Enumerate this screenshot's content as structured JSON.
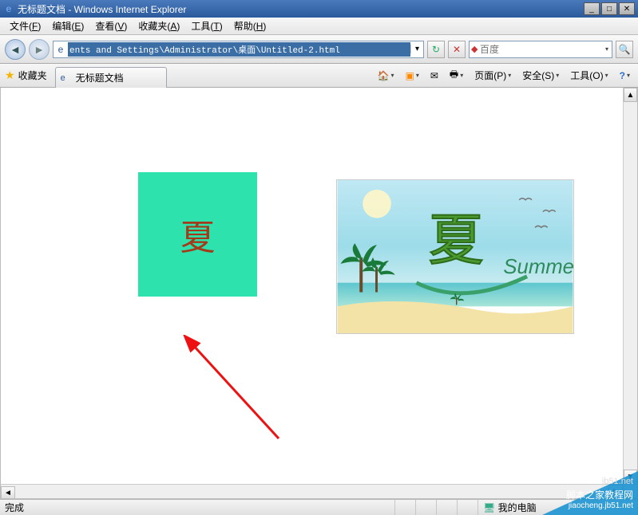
{
  "titlebar": {
    "text": "无标题文档 - Windows Internet Explorer"
  },
  "menubar": {
    "items": [
      {
        "label": "文件",
        "accel": "F"
      },
      {
        "label": "编辑",
        "accel": "E"
      },
      {
        "label": "查看",
        "accel": "V"
      },
      {
        "label": "收藏夹",
        "accel": "A"
      },
      {
        "label": "工具",
        "accel": "T"
      },
      {
        "label": "帮助",
        "accel": "H"
      }
    ]
  },
  "navbar": {
    "address_value": "ents and Settings\\Administrator\\桌面\\Untitled-2.html",
    "search_placeholder": "百度"
  },
  "favbar": {
    "fav_label": "收藏夹",
    "tab_title": "无标题文档"
  },
  "cmdbar": {
    "home": "主页",
    "feeds": "订阅",
    "read": "阅读",
    "print": "打印",
    "page_label": "页面(P)",
    "safety_label": "安全(S)",
    "tools_label": "工具(O)",
    "help": "帮助"
  },
  "content": {
    "green_box_char": "夏",
    "summer_text": "夏",
    "summer_sub": "Summer"
  },
  "statusbar": {
    "left": "完成",
    "zone": "我的电脑"
  },
  "watermark": {
    "url": "jb51.net",
    "line1": "脚本之家教程网",
    "line2": "jiaocheng.jb51.net"
  }
}
